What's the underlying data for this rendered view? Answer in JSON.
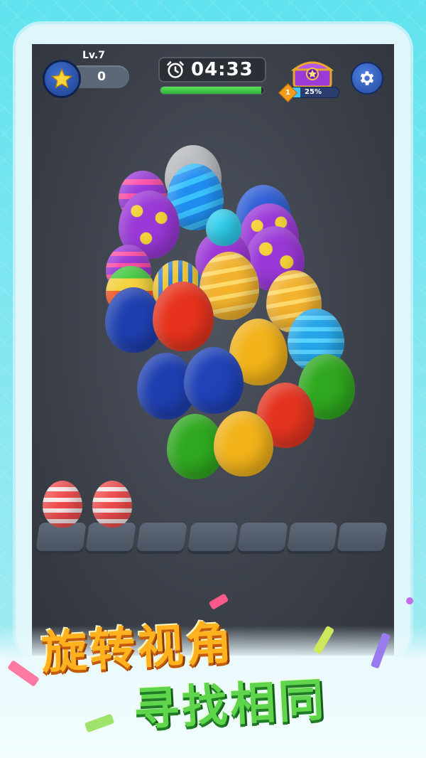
{
  "hud": {
    "level": "Lv.7",
    "score": "0",
    "timer": "04:33",
    "timer_progress": 0.97,
    "chest_level": "1",
    "chest_percent": "25%",
    "chest_progress": 0.25
  },
  "promo": {
    "line1": "旋转视角",
    "line2": "寻找相同"
  },
  "colors": {
    "timer_fill": "#3fcb41",
    "title1": "#ffb21e",
    "title2": "#5ed54b",
    "screen_bg": "#3b4049"
  },
  "icons": [
    "star-icon",
    "alarm-clock-icon",
    "treasure-chest-icon",
    "gear-icon"
  ],
  "slots": {
    "total": 7,
    "filled": 2,
    "filled_item": "red-striped-balloon"
  }
}
